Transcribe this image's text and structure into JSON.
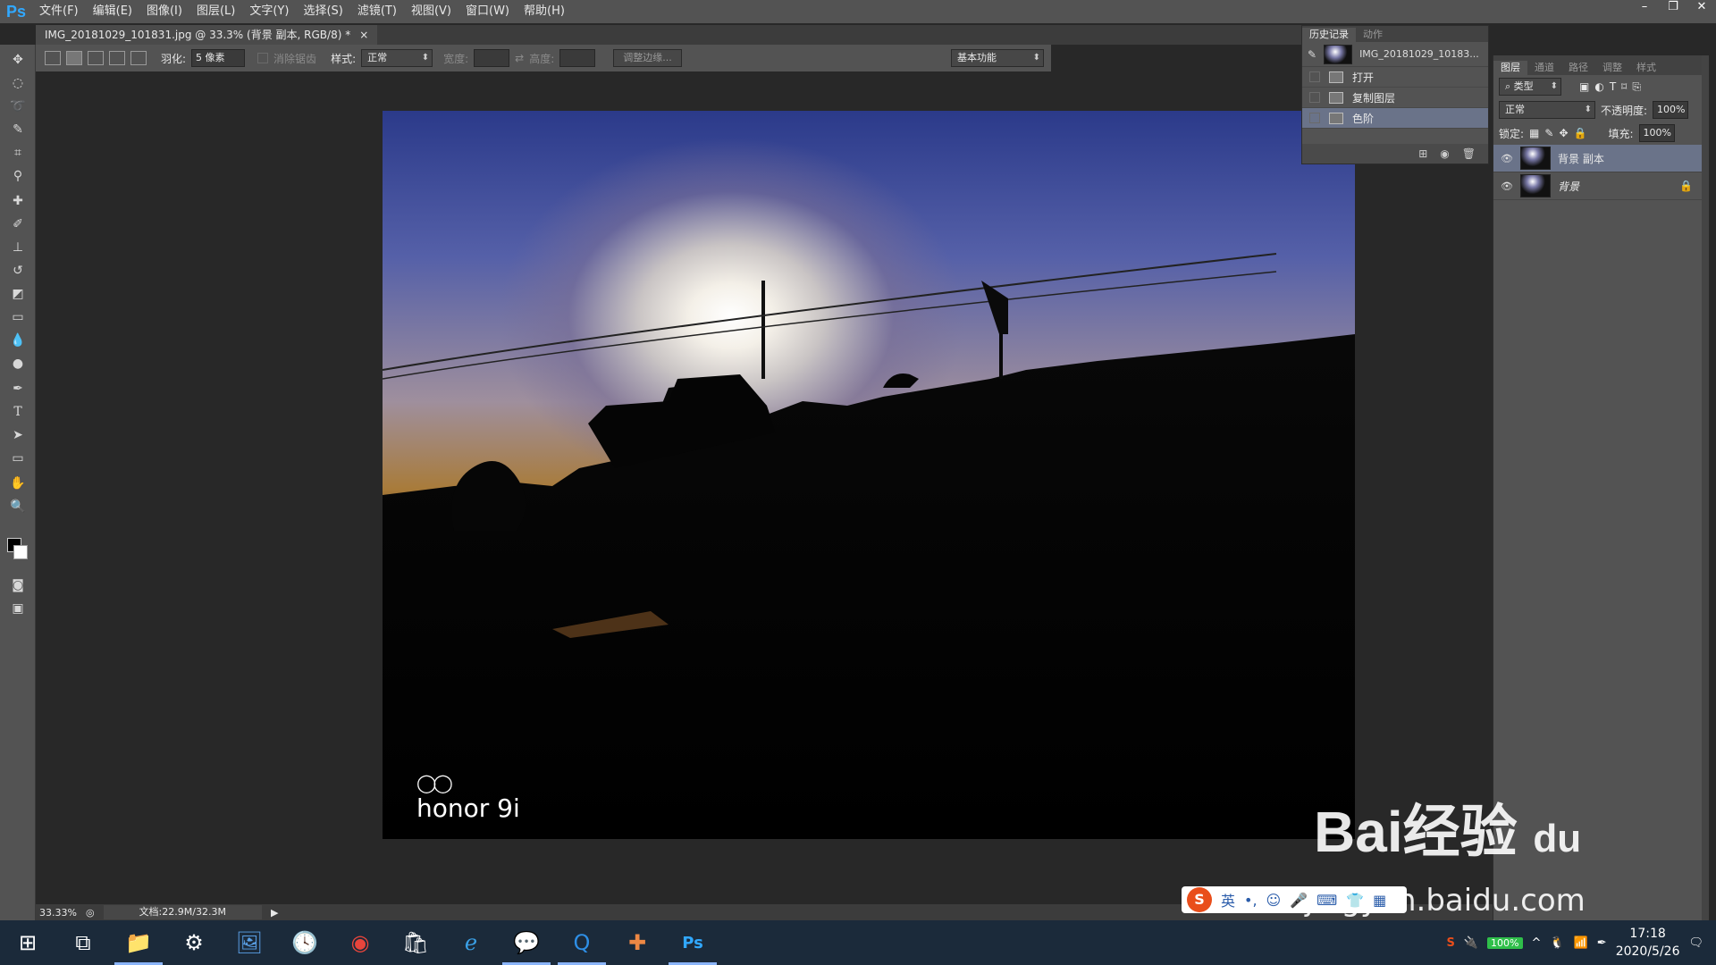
{
  "app": {
    "logo": "Ps"
  },
  "menu": [
    "文件(F)",
    "编辑(E)",
    "图像(I)",
    "图层(L)",
    "文字(Y)",
    "选择(S)",
    "滤镜(T)",
    "视图(V)",
    "窗口(W)",
    "帮助(H)"
  ],
  "window_controls": {
    "minimize": "–",
    "restore": "❐",
    "close": "✕"
  },
  "document_tab": {
    "title": "IMG_20181029_101831.jpg @ 33.3% (背景 副本, RGB/8) *",
    "close": "×"
  },
  "options": {
    "feather_label": "羽化:",
    "feather_value": "5 像素",
    "antialias_label": "消除锯齿",
    "style_label": "样式:",
    "style_value": "正常",
    "width_label": "宽度:",
    "height_label": "高度:",
    "refine_button": "调整边缘...",
    "workspace": "基本功能"
  },
  "status": {
    "zoom": "33.33%",
    "doc": "文档:22.9M/32.3M"
  },
  "history": {
    "tabs": [
      "历史记录",
      "动作"
    ],
    "snapshot": "IMG_20181029_10183...",
    "items": [
      "打开",
      "复制图层",
      "色阶"
    ]
  },
  "layers": {
    "tabs": [
      "图层",
      "通道",
      "路径",
      "调整",
      "样式"
    ],
    "filter_label": "类型",
    "blend_mode": "正常",
    "opacity_label": "不透明度:",
    "opacity_value": "100%",
    "lock_label": "锁定:",
    "fill_label": "填充:",
    "fill_value": "100%",
    "items": [
      {
        "name": "背景 副本"
      },
      {
        "name": "背景"
      }
    ]
  },
  "photo": {
    "brand": "honor 9i"
  },
  "overlay": {
    "baidu": "Bai经验",
    "baidu_du": "du",
    "url": "jingyan.baidu.com"
  },
  "ime": {
    "label": "英"
  },
  "taskbar": {
    "battery": "100%",
    "time": "17:18",
    "date": "2020/5/26"
  }
}
